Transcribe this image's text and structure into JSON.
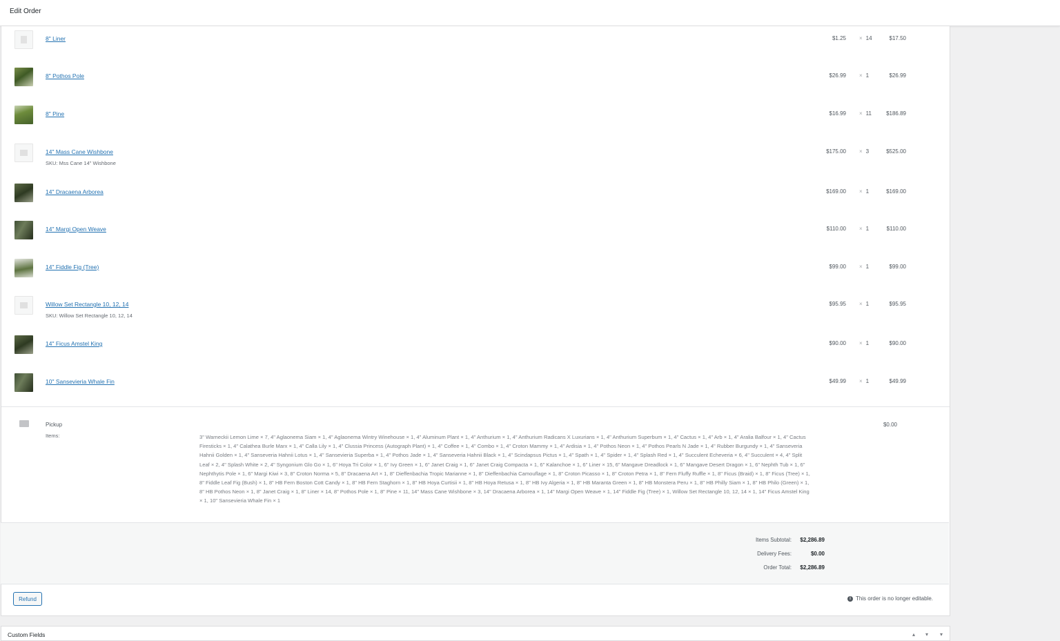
{
  "header": {
    "title": "Edit Order"
  },
  "items": [
    {
      "name": "8\" Liner",
      "sku": "",
      "price": "$1.25",
      "qty": "14",
      "total": "$17.50",
      "thumb": "placeholder"
    },
    {
      "name": "8\" Pothos Pole",
      "sku": "",
      "price": "$26.99",
      "qty": "1",
      "total": "$26.99",
      "thumb": "green"
    },
    {
      "name": "8\" Pine",
      "sku": "",
      "price": "$16.99",
      "qty": "11",
      "total": "$186.89",
      "thumb": "green2"
    },
    {
      "name": "14\" Mass Cane Wishbone",
      "sku": "SKU: Mss Cane 14\" Wishbone",
      "price": "$175.00",
      "qty": "3",
      "total": "$525.00",
      "thumb": "sku-ph"
    },
    {
      "name": "14\" Dracaena Arborea",
      "sku": "",
      "price": "$169.00",
      "qty": "1",
      "total": "$169.00",
      "thumb": "dark"
    },
    {
      "name": "14\" Margi Open Weave",
      "sku": "",
      "price": "$110.00",
      "qty": "1",
      "total": "$110.00",
      "thumb": "dark2"
    },
    {
      "name": "14\" Fiddle Fig (Tree)",
      "sku": "",
      "price": "$99.00",
      "qty": "1",
      "total": "$99.00",
      "thumb": "light"
    },
    {
      "name": "Willow Set Rectangle 10, 12, 14",
      "sku": "SKU: Willow Set Rectangle 10, 12, 14",
      "price": "$95.95",
      "qty": "1",
      "total": "$95.95",
      "thumb": "sku-ph"
    },
    {
      "name": "14\" Ficus Amstel King",
      "sku": "",
      "price": "$90.00",
      "qty": "1",
      "total": "$90.00",
      "thumb": "dark"
    },
    {
      "name": "10\" Sansevieria Whale Fin",
      "sku": "",
      "price": "$49.99",
      "qty": "1",
      "total": "$49.99",
      "thumb": "dark2"
    }
  ],
  "qty_prefix": "×",
  "shipping": {
    "title": "Pickup",
    "items_label": "Items:",
    "items_text": "3\" Warneckii Lemon Lime × 7, 4\" Aglaonema Siam × 1, 4\" Aglaonema Wintry Winehouse × 1, 4\" Aluminum Plant × 1, 4\" Anthurium × 1, 4\" Anthurium Radicans X Luxurians × 1, 4\" Anthurium Superbum × 1, 4\" Cactus × 1, 4\" Arb × 1, 4\" Aralia Balfour × 1, 4\" Cactus Firesticks × 1, 4\" Calathea Burle Marx × 1, 4\" Calla Lily × 1, 4\" Clussia Princess (Autograph Plant) × 1, 4\" Coffee × 1, 4\" Combo × 1, 4\" Croton Mammy × 1, 4\" Ardisia × 1, 4\" Pothos Neon × 1, 4\" Pothos Pearls N Jade × 1, 4\" Rubber Burgundy × 1, 4\" Sanseveria Hahnii Golden × 1, 4\" Sanseveria Hahnii Lotus × 1, 4\" Sansevieria Superba × 1, 4\" Pothos Jade × 1, 4\" Sanseveria Hahnii Black × 1, 4\" Scindapsus Pictus × 1, 4\" Spath × 1, 4\" Spider × 1, 4\" Splash Red × 1, 4\" Succulent Echeveria × 6, 4\" Succulent × 4, 4\" Split Leaf × 2, 4\" Splash White × 2, 4\" Syngonium Glo Go × 1, 6\" Hoya Tri Color × 1, 6\" Ivy Green × 1, 6\" Janet Craig × 1, 6\" Janet Craig Compacta × 1, 6\" Kalanchoe × 1, 6\" Liner × 15, 6\" Mangave Dreadlock × 1, 6\" Mangave Desert Dragon × 1, 6\" Nephth Tub × 1, 6\" Nephthytis Pole × 1, 6\" Margi Kiwi × 3, 8\" Croton Norma × 5, 8\" Dracaena Art × 1, 8\" Dieffenbachia Tropic Marianne × 1, 8\" Dieffenbachia Camouflage × 1, 8\" Croton Picasso × 1, 8\" Croton Petra × 1, 8\" Fern Fluffy Ruffle × 1, 8\" Ficus (Braid) × 1, 8\" Ficus (Tree) × 1, 8\" Fiddle Leaf Fig (Bush) × 1, 8\" HB Fern Boston Cott Candy × 1, 8\" HB Fern Staghorn × 1, 8\" HB Hoya Curtisii × 1, 8\" HB Hoya Retusa × 1, 8\" HB Ivy Algeria × 1, 8\" HB Maranta Green × 1, 8\" HB Monstera Peru × 1, 8\" HB Philly Siam × 1, 8\" HB Philo (Green) × 1, 8\" HB Pothos Neon × 1, 8\" Janet Craig × 1, 8\" Liner × 14, 8\" Pothos Pole × 1, 8\" Pine × 11, 14\" Mass Cane Wishbone × 3, 14\" Dracaena Arborea × 1, 14\" Margi Open Weave × 1, 14\" Fiddle Fig (Tree) × 1, Willow Set Rectangle 10, 12, 14 × 1, 14\" Ficus Amstel King × 1, 10\" Sansevieria Whale Fin × 1",
    "cost": "$0.00"
  },
  "totals": {
    "subtotal_label": "Items Subtotal:",
    "subtotal_value": "$2,286.89",
    "delivery_label": "Delivery Fees:",
    "delivery_value": "$0.00",
    "order_label": "Order Total:",
    "order_value": "$2,286.89"
  },
  "actions": {
    "refund_label": "Refund",
    "info_icon": "i",
    "not_editable": "This order is no longer editable."
  },
  "custom_fields": {
    "title": "Custom Fields"
  }
}
